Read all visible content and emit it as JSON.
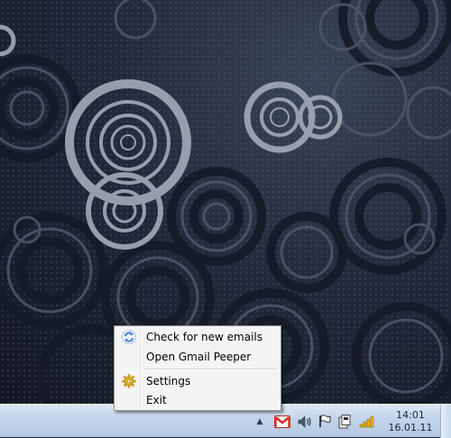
{
  "context_menu": {
    "items": [
      {
        "label": "Check for new emails",
        "icon": "refresh-icon"
      },
      {
        "label": "Open Gmail Peeper",
        "icon": ""
      },
      {
        "label": "Settings",
        "icon": "gear-icon"
      },
      {
        "label": "Exit",
        "icon": ""
      }
    ]
  },
  "taskbar": {
    "tray_icons": [
      "chevron-up-icon",
      "gmail-icon",
      "volume-icon",
      "action-center-flag-icon",
      "device-icon",
      "network-signal-icon"
    ],
    "clock": {
      "time": "14:01",
      "date": "16.01.11"
    }
  },
  "colors": {
    "gmail_red": "#d93025",
    "gear_yellow": "#e8b820",
    "refresh_blue": "#3a77d8"
  }
}
